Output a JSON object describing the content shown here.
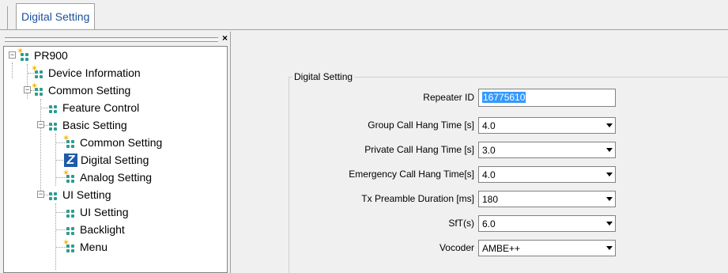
{
  "tab": {
    "label": "Digital Setting"
  },
  "tree": {
    "close_label": "×",
    "nodes": [
      {
        "label": "PR900"
      },
      {
        "label": "Device Information"
      },
      {
        "label": "Common Setting"
      },
      {
        "label": "Feature Control"
      },
      {
        "label": "Basic Setting"
      },
      {
        "label": "Common Setting"
      },
      {
        "label": "Digital Setting"
      },
      {
        "label": "Analog Setting"
      },
      {
        "label": "UI Setting"
      },
      {
        "label": "UI Setting"
      },
      {
        "label": "Backlight"
      },
      {
        "label": "Menu"
      }
    ],
    "expanders": {
      "collapse": "−"
    }
  },
  "form": {
    "group_title": "Digital Setting",
    "fields": [
      {
        "label": "Repeater ID",
        "value": "16775610",
        "type": "text"
      },
      {
        "label": "Group Call Hang Time [s]",
        "value": "4.0",
        "type": "select"
      },
      {
        "label": "Private Call Hang Time [s]",
        "value": "3.0",
        "type": "select"
      },
      {
        "label": "Emergency Call Hang Time[s]",
        "value": "4.0",
        "type": "select"
      },
      {
        "label": "Tx Preamble Duration [ms]",
        "value": "180",
        "type": "select"
      },
      {
        "label": "SfT(s)",
        "value": "6.0",
        "type": "select"
      },
      {
        "label": "Vocoder",
        "value": "AMBE++",
        "type": "select"
      }
    ]
  },
  "colors": {
    "tab_text": "#1b4f9c",
    "selection": "#3399ff",
    "digital_icon": "#1e5aa8"
  }
}
